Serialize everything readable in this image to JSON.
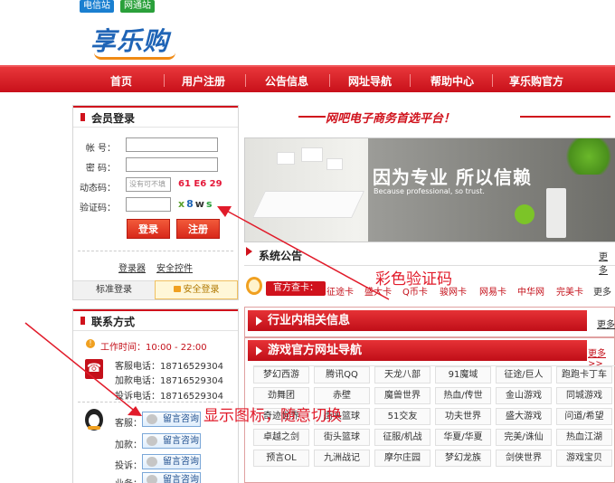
{
  "top_tabs": [
    "电信站",
    "网通站"
  ],
  "logo": "享乐购",
  "nav": [
    "首页",
    "用户注册",
    "公告信息",
    "网址导航",
    "帮助中心",
    "享乐购官方"
  ],
  "login": {
    "title": "会员登录",
    "account_label": "帐 号：",
    "password_label": "密 码：",
    "dynamic_label": "动态码：",
    "dynamic_placeholder": "没有可不填",
    "dynamic_hint": "61 E6 29",
    "captcha_label": "验证码：",
    "captcha_chars": [
      "x",
      "8",
      "w",
      "s"
    ],
    "login_btn": "登录",
    "register_btn": "注册",
    "link_login_tool": "登录器",
    "link_security": "安全控件",
    "tab_standard": "标准登录",
    "tab_secure": "安全登录"
  },
  "contact": {
    "title": "联系方式",
    "work_time": "工作时间：10:00 - 22:00",
    "phones": [
      "客服电话：18716529304",
      "加款电话：18716529304",
      "投诉电话：18716529304"
    ],
    "rows": [
      {
        "label": "客服：",
        "btn": "留言咨询"
      },
      {
        "label": "加款：",
        "btn": "留言咨询"
      },
      {
        "label": "投诉：",
        "btn": "留言咨询"
      },
      {
        "label": "业务：",
        "btn": "留言咨询"
      }
    ]
  },
  "banner": {
    "tagline": "网吧电子商务首选平台！",
    "headline": "因为专业 所以信赖",
    "subline": "Because professional, so trust."
  },
  "notice": {
    "title": "系统公告",
    "more": "更多"
  },
  "cards": {
    "tag": "官方查卡：",
    "links": [
      "征途卡",
      "盛大卡",
      "Q币卡",
      "骏网卡",
      "网易卡",
      "中华网",
      "完美卡",
      "更多"
    ]
  },
  "industry": {
    "title": "行业内相关信息",
    "more": "更多"
  },
  "games": {
    "title": "游戏官方网址导航",
    "more": "更多>>",
    "cells": [
      [
        "梦幻西游",
        "腾讯QQ",
        "天龙八部",
        "91魔域",
        "征途/巨人",
        "跑跑卡丁车"
      ],
      [
        "劲舞团",
        "赤壁",
        "魔兽世界",
        "热血/传世",
        "金山游戏",
        "同城游戏"
      ],
      [
        "奇迹世界",
        "街头篮球",
        "51交友",
        "功夫世界",
        "盛大游戏",
        "问道/希望"
      ],
      [
        "卓越之剑",
        "街头篮球",
        "征服/机战",
        "华夏/华夏",
        "完美/诛仙",
        "热血江湖"
      ],
      [
        "预言OL",
        "九洲战记",
        "摩尔庄园",
        "梦幻龙族",
        "剑侠世界",
        "游戏宝贝"
      ]
    ]
  },
  "annotations": {
    "captcha": "彩色验证码",
    "icon": "显示图标，随意切换"
  }
}
